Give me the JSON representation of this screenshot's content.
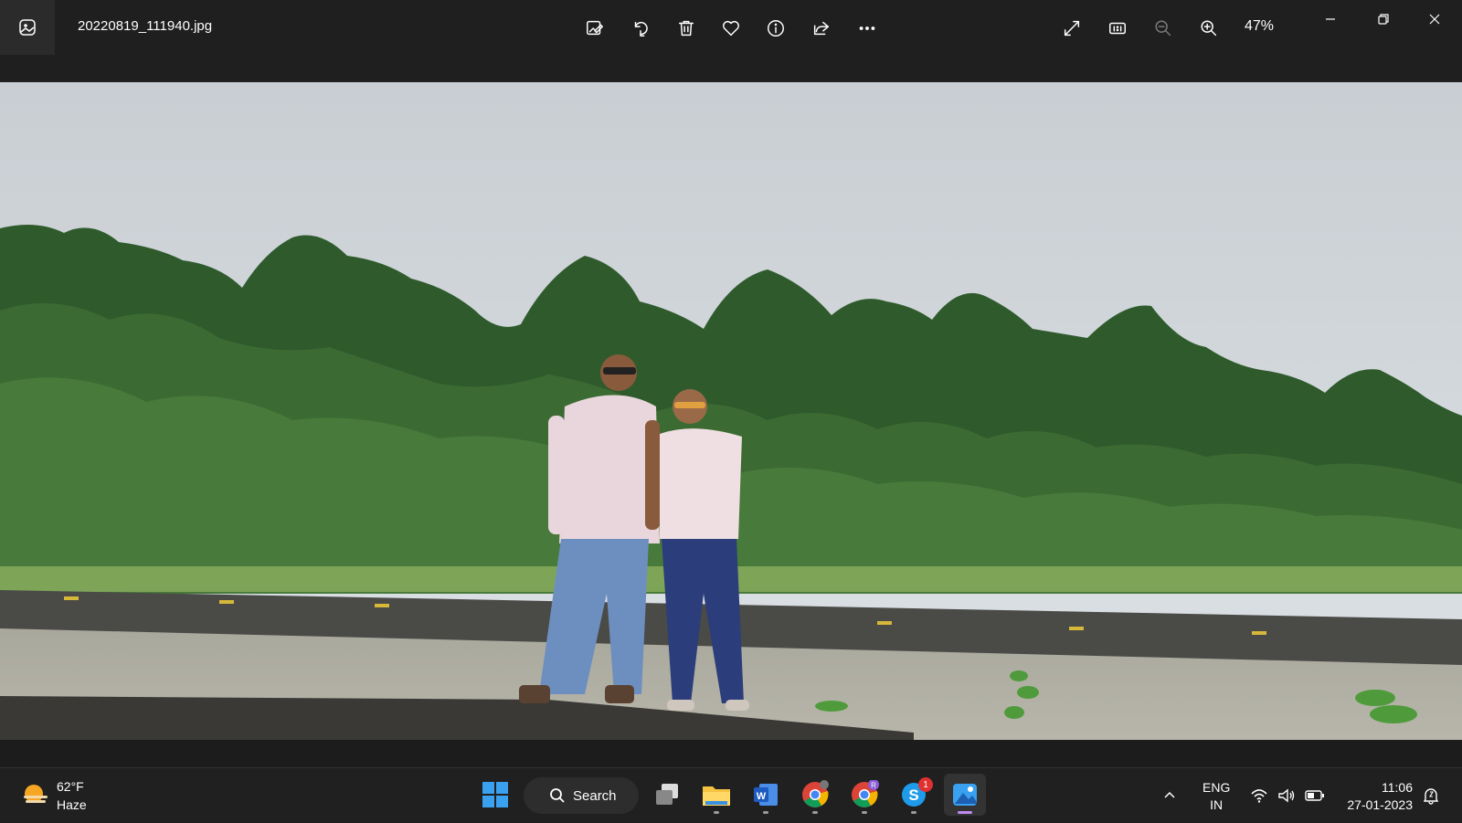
{
  "window": {
    "filename": "20220819_111940.jpg",
    "zoom": "47%"
  },
  "toolbar": {
    "items": [
      {
        "name": "edit-image",
        "icon": "edit-image-icon"
      },
      {
        "name": "rotate",
        "icon": "rotate-icon"
      },
      {
        "name": "delete",
        "icon": "trash-icon"
      },
      {
        "name": "favorite",
        "icon": "heart-icon"
      },
      {
        "name": "file-info",
        "icon": "info-icon"
      },
      {
        "name": "share",
        "icon": "share-icon"
      },
      {
        "name": "more",
        "icon": "more-icon"
      }
    ],
    "right_items": [
      {
        "name": "full-screen",
        "icon": "expand-icon"
      },
      {
        "name": "actual-size",
        "icon": "actual-size-icon"
      },
      {
        "name": "zoom-out",
        "icon": "zoom-out-icon",
        "disabled": true
      },
      {
        "name": "zoom-in",
        "icon": "zoom-in-icon"
      }
    ]
  },
  "window_controls": [
    "minimize",
    "restore",
    "close"
  ],
  "taskbar": {
    "weather": {
      "temp": "62°F",
      "condition": "Haze"
    },
    "search_label": "Search",
    "apps": [
      "start",
      "task-view",
      "file-explorer",
      "word",
      "chrome",
      "chrome-profile",
      "skype",
      "photos"
    ],
    "chrome_profile_letter": "R",
    "skype_badge": "1",
    "tray": {
      "lang_line1": "ENG",
      "lang_line2": "IN",
      "time": "11:06",
      "date": "27-01-2023"
    },
    "colors": {
      "accent": "#c18af0",
      "badge": "#e03030"
    }
  }
}
